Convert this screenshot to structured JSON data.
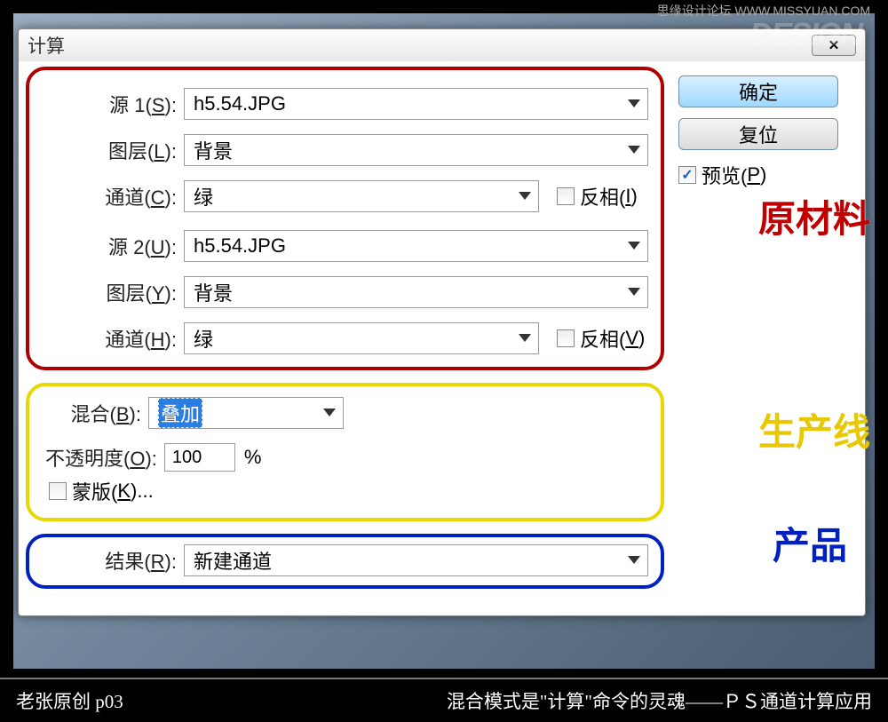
{
  "dialog": {
    "title": "计算",
    "source1": {
      "label": "源 1(",
      "hotkey": "S",
      "label_end": "):",
      "value": "h5.54.JPG",
      "layer_label": "图层(",
      "layer_hotkey": "L",
      "layer_value": "背景",
      "channel_label": "通道(",
      "channel_hotkey": "C",
      "channel_value": "绿",
      "invert_label": "反相(",
      "invert_hotkey": "I",
      "invert_end": ")"
    },
    "source2": {
      "label": "源 2(",
      "hotkey": "U",
      "value": "h5.54.JPG",
      "layer_hotkey": "Y",
      "layer_value": "背景",
      "channel_hotkey": "H",
      "channel_value": "绿",
      "invert_hotkey": "V"
    },
    "blend": {
      "label": "混合(",
      "hotkey": "B",
      "value": "叠加",
      "opacity_label": "不透明度(",
      "opacity_hotkey": "O",
      "opacity_value": "100",
      "percent": "%",
      "mask_label": "蒙版(",
      "mask_hotkey": "K",
      "mask_end": ")..."
    },
    "result": {
      "label": "结果(",
      "hotkey": "R",
      "value": "新建通道"
    },
    "buttons": {
      "ok": "确定",
      "reset": "复位",
      "preview": "预览(",
      "preview_hotkey": "P",
      "preview_end": ")"
    }
  },
  "annotations": {
    "red": "原材料",
    "yellow": "生产线",
    "blue": "产品"
  },
  "footer": {
    "left": "老张原创    p03",
    "right": "混合模式是\"计算\"命令的灵魂——ＰＳ通道计算应用"
  },
  "watermark": {
    "top": "思缘设计论坛  WWW.MISSYUAN.COM",
    "logo": "DESIGN"
  }
}
